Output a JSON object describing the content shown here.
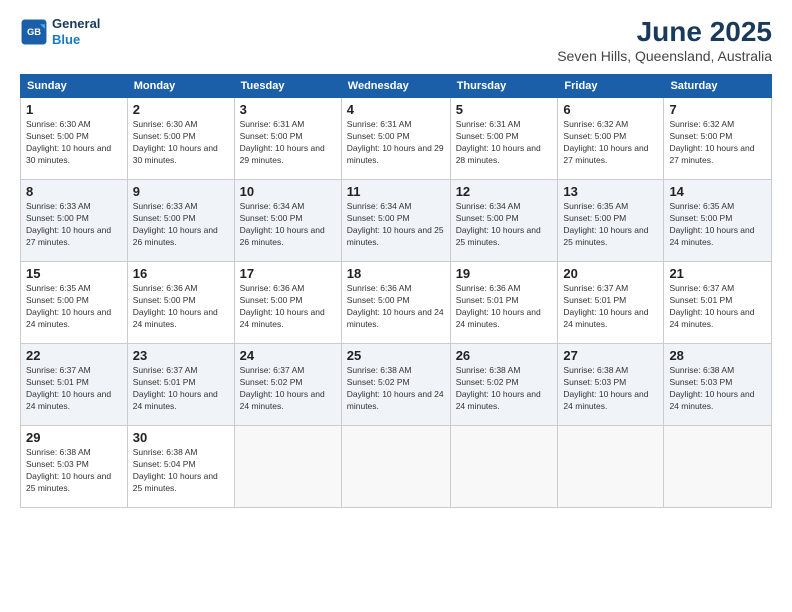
{
  "logo": {
    "line1": "General",
    "line2": "Blue"
  },
  "title": "June 2025",
  "location": "Seven Hills, Queensland, Australia",
  "days_of_week": [
    "Sunday",
    "Monday",
    "Tuesday",
    "Wednesday",
    "Thursday",
    "Friday",
    "Saturday"
  ],
  "weeks": [
    [
      {
        "day": "1",
        "sunrise": "6:30 AM",
        "sunset": "5:00 PM",
        "daylight": "10 hours and 30 minutes."
      },
      {
        "day": "2",
        "sunrise": "6:30 AM",
        "sunset": "5:00 PM",
        "daylight": "10 hours and 30 minutes."
      },
      {
        "day": "3",
        "sunrise": "6:31 AM",
        "sunset": "5:00 PM",
        "daylight": "10 hours and 29 minutes."
      },
      {
        "day": "4",
        "sunrise": "6:31 AM",
        "sunset": "5:00 PM",
        "daylight": "10 hours and 29 minutes."
      },
      {
        "day": "5",
        "sunrise": "6:31 AM",
        "sunset": "5:00 PM",
        "daylight": "10 hours and 28 minutes."
      },
      {
        "day": "6",
        "sunrise": "6:32 AM",
        "sunset": "5:00 PM",
        "daylight": "10 hours and 27 minutes."
      },
      {
        "day": "7",
        "sunrise": "6:32 AM",
        "sunset": "5:00 PM",
        "daylight": "10 hours and 27 minutes."
      }
    ],
    [
      {
        "day": "8",
        "sunrise": "6:33 AM",
        "sunset": "5:00 PM",
        "daylight": "10 hours and 27 minutes."
      },
      {
        "day": "9",
        "sunrise": "6:33 AM",
        "sunset": "5:00 PM",
        "daylight": "10 hours and 26 minutes."
      },
      {
        "day": "10",
        "sunrise": "6:34 AM",
        "sunset": "5:00 PM",
        "daylight": "10 hours and 26 minutes."
      },
      {
        "day": "11",
        "sunrise": "6:34 AM",
        "sunset": "5:00 PM",
        "daylight": "10 hours and 25 minutes."
      },
      {
        "day": "12",
        "sunrise": "6:34 AM",
        "sunset": "5:00 PM",
        "daylight": "10 hours and 25 minutes."
      },
      {
        "day": "13",
        "sunrise": "6:35 AM",
        "sunset": "5:00 PM",
        "daylight": "10 hours and 25 minutes."
      },
      {
        "day": "14",
        "sunrise": "6:35 AM",
        "sunset": "5:00 PM",
        "daylight": "10 hours and 24 minutes."
      }
    ],
    [
      {
        "day": "15",
        "sunrise": "6:35 AM",
        "sunset": "5:00 PM",
        "daylight": "10 hours and 24 minutes."
      },
      {
        "day": "16",
        "sunrise": "6:36 AM",
        "sunset": "5:00 PM",
        "daylight": "10 hours and 24 minutes."
      },
      {
        "day": "17",
        "sunrise": "6:36 AM",
        "sunset": "5:00 PM",
        "daylight": "10 hours and 24 minutes."
      },
      {
        "day": "18",
        "sunrise": "6:36 AM",
        "sunset": "5:00 PM",
        "daylight": "10 hours and 24 minutes."
      },
      {
        "day": "19",
        "sunrise": "6:36 AM",
        "sunset": "5:01 PM",
        "daylight": "10 hours and 24 minutes."
      },
      {
        "day": "20",
        "sunrise": "6:37 AM",
        "sunset": "5:01 PM",
        "daylight": "10 hours and 24 minutes."
      },
      {
        "day": "21",
        "sunrise": "6:37 AM",
        "sunset": "5:01 PM",
        "daylight": "10 hours and 24 minutes."
      }
    ],
    [
      {
        "day": "22",
        "sunrise": "6:37 AM",
        "sunset": "5:01 PM",
        "daylight": "10 hours and 24 minutes."
      },
      {
        "day": "23",
        "sunrise": "6:37 AM",
        "sunset": "5:01 PM",
        "daylight": "10 hours and 24 minutes."
      },
      {
        "day": "24",
        "sunrise": "6:37 AM",
        "sunset": "5:02 PM",
        "daylight": "10 hours and 24 minutes."
      },
      {
        "day": "25",
        "sunrise": "6:38 AM",
        "sunset": "5:02 PM",
        "daylight": "10 hours and 24 minutes."
      },
      {
        "day": "26",
        "sunrise": "6:38 AM",
        "sunset": "5:02 PM",
        "daylight": "10 hours and 24 minutes."
      },
      {
        "day": "27",
        "sunrise": "6:38 AM",
        "sunset": "5:03 PM",
        "daylight": "10 hours and 24 minutes."
      },
      {
        "day": "28",
        "sunrise": "6:38 AM",
        "sunset": "5:03 PM",
        "daylight": "10 hours and 24 minutes."
      }
    ],
    [
      {
        "day": "29",
        "sunrise": "6:38 AM",
        "sunset": "5:03 PM",
        "daylight": "10 hours and 25 minutes."
      },
      {
        "day": "30",
        "sunrise": "6:38 AM",
        "sunset": "5:04 PM",
        "daylight": "10 hours and 25 minutes."
      },
      null,
      null,
      null,
      null,
      null
    ]
  ],
  "labels": {
    "sunrise": "Sunrise:",
    "sunset": "Sunset:",
    "daylight": "Daylight:"
  }
}
